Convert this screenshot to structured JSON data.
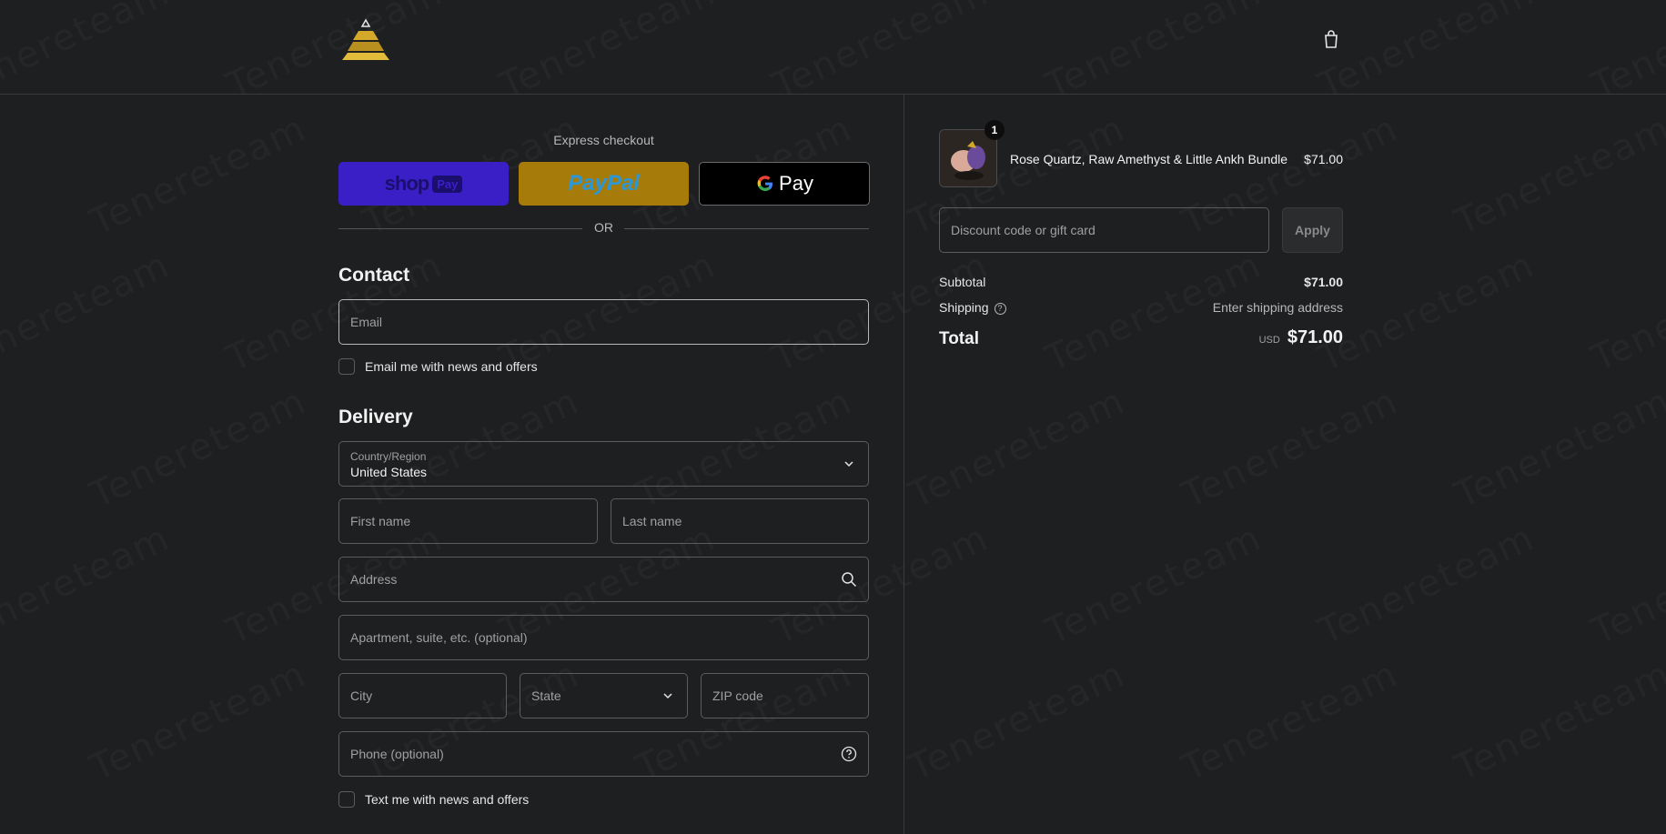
{
  "header": {
    "logo_icon": "pyramid-logo-icon",
    "cart_icon": "shopping-bag-icon"
  },
  "express": {
    "title": "Express checkout",
    "shop_label": "shop",
    "shop_pay_label": "Pay",
    "paypal_label": "PayPal",
    "gpay_label": "Pay",
    "or_label": "OR"
  },
  "contact": {
    "title": "Contact",
    "email_placeholder": "Email",
    "newsletter_label": "Email me with news and offers"
  },
  "delivery": {
    "title": "Delivery",
    "country_label": "Country/Region",
    "country_value": "United States",
    "first_name_placeholder": "First name",
    "last_name_placeholder": "Last name",
    "address_placeholder": "Address",
    "apartment_placeholder": "Apartment, suite, etc. (optional)",
    "city_placeholder": "City",
    "state_label": "State",
    "zip_placeholder": "ZIP code",
    "phone_placeholder": "Phone (optional)",
    "sms_label": "Text me with news and offers"
  },
  "summary": {
    "items": [
      {
        "name": "Rose Quartz, Raw Amethyst & Little Ankh Bundle",
        "price": "$71.00",
        "quantity": "1"
      }
    ],
    "discount_placeholder": "Discount code or gift card",
    "apply_label": "Apply",
    "subtotal_label": "Subtotal",
    "subtotal_value": "$71.00",
    "shipping_label": "Shipping",
    "shipping_value": "Enter shipping address",
    "total_label": "Total",
    "total_currency": "USD",
    "total_value": "$71.00"
  },
  "watermark_text": "Tenereteam",
  "colors": {
    "background": "#1e1f21",
    "shop_pay": "#3a1fc7",
    "paypal": "#a77b0a",
    "gpay": "#000000"
  }
}
